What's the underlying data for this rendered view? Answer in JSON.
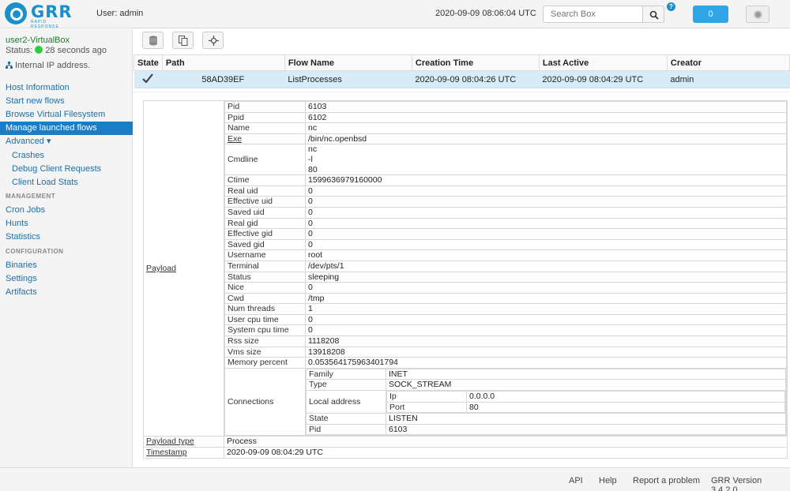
{
  "header": {
    "logo_text": "GRR",
    "logo_sub": "RAPID RESPONSE",
    "user": "User: admin",
    "clock": "2020-09-09 08:06:04 UTC",
    "search_placeholder": "Search Box",
    "notification_count": "0"
  },
  "sidebar": {
    "client_name": "user2-VirtualBox",
    "status_prefix": "Status:",
    "status_text": "28 seconds ago",
    "ip_text": "Internal IP address.",
    "items": [
      {
        "label": "Host Information"
      },
      {
        "label": "Start new flows"
      },
      {
        "label": "Browse Virtual Filesystem"
      },
      {
        "label": "Manage launched flows"
      },
      {
        "label": "Advanced ▾"
      },
      {
        "label": "Crashes"
      },
      {
        "label": "Debug Client Requests"
      },
      {
        "label": "Client Load Stats"
      },
      {
        "label": "MANAGEMENT"
      },
      {
        "label": "Cron Jobs"
      },
      {
        "label": "Hunts"
      },
      {
        "label": "Statistics"
      },
      {
        "label": "CONFIGURATION"
      },
      {
        "label": "Binaries"
      },
      {
        "label": "Settings"
      },
      {
        "label": "Artifacts"
      }
    ]
  },
  "flow_table": {
    "columns": [
      "State",
      "Path",
      "Flow Name",
      "Creation Time",
      "Last Active",
      "Creator"
    ],
    "row": {
      "path": "58AD39EF",
      "flow_name": "ListProcesses",
      "creation_time": "2020-09-09 08:04:26 UTC",
      "last_active": "2020-09-09 08:04:29 UTC",
      "creator": "admin"
    }
  },
  "payload": {
    "label": "Payload",
    "fields": {
      "pid": {
        "k": "Pid",
        "v": "6103"
      },
      "ppid": {
        "k": "Ppid",
        "v": "6102"
      },
      "name": {
        "k": "Name",
        "v": "nc"
      },
      "exe": {
        "k": "Exe",
        "v": "/bin/nc.openbsd"
      },
      "cmdline": {
        "k": "Cmdline",
        "v1": "nc",
        "v2": "-l",
        "v3": "80"
      },
      "ctime": {
        "k": "Ctime",
        "v": "1599636979160000"
      },
      "real_uid": {
        "k": "Real uid",
        "v": "0"
      },
      "effective_uid": {
        "k": "Effective uid",
        "v": "0"
      },
      "saved_uid": {
        "k": "Saved uid",
        "v": "0"
      },
      "real_gid": {
        "k": "Real gid",
        "v": "0"
      },
      "effective_gid": {
        "k": "Effective gid",
        "v": "0"
      },
      "saved_gid": {
        "k": "Saved gid",
        "v": "0"
      },
      "username": {
        "k": "Username",
        "v": "root"
      },
      "terminal": {
        "k": "Terminal",
        "v": "/dev/pts/1"
      },
      "status": {
        "k": "Status",
        "v": "sleeping"
      },
      "nice": {
        "k": "Nice",
        "v": "0"
      },
      "cwd": {
        "k": "Cwd",
        "v": "/tmp"
      },
      "num_threads": {
        "k": "Num threads",
        "v": "1"
      },
      "user_cpu_time": {
        "k": "User cpu time",
        "v": "0"
      },
      "system_cpu_time": {
        "k": "System cpu time",
        "v": "0"
      },
      "rss_size": {
        "k": "Rss size",
        "v": "1118208"
      },
      "vms_size": {
        "k": "Vms size",
        "v": "13918208"
      },
      "memory_percent": {
        "k": "Memory percent",
        "v": "0.053564175963401794"
      }
    },
    "connections": {
      "k": "Connections",
      "family": {
        "k": "Family",
        "v": "INET"
      },
      "type": {
        "k": "Type",
        "v": "SOCK_STREAM"
      },
      "local_address": {
        "k": "Local address",
        "ip_k": "Ip",
        "ip_v": "0.0.0.0",
        "port_k": "Port",
        "port_v": "80"
      },
      "state": {
        "k": "State",
        "v": "LISTEN"
      },
      "pid": {
        "k": "Pid",
        "v": "6103"
      }
    },
    "payload_type": {
      "k": "Payload type",
      "v": "Process"
    },
    "timestamp": {
      "k": "Timestamp",
      "v": "2020-09-09 08:04:29 UTC"
    }
  },
  "footer": {
    "api": "API",
    "help": "Help",
    "report": "Report a problem",
    "version": "GRR Version 3.4.2.0"
  },
  "colors": {
    "accent": "#1b7dc5",
    "row_selected": "#d7ecf7",
    "status_online": "#2ecc40"
  }
}
